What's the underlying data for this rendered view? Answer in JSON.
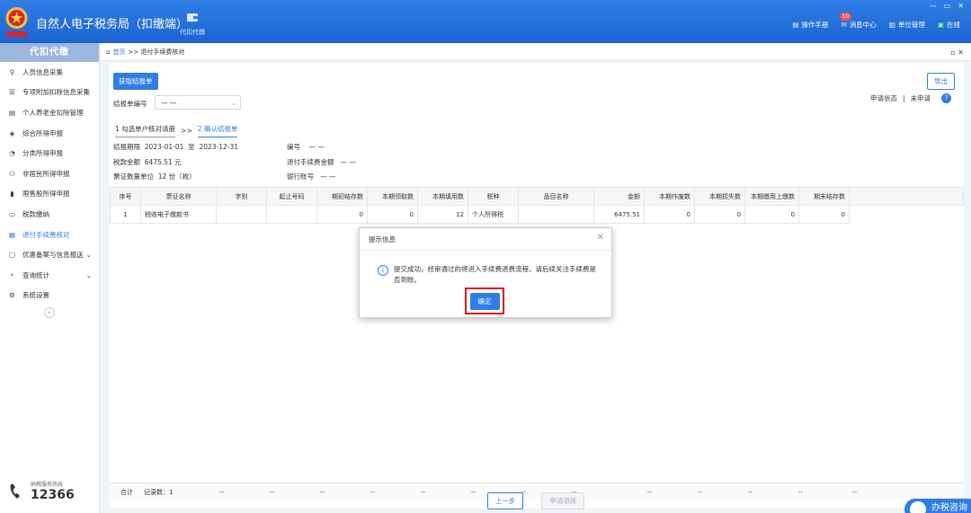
{
  "app": {
    "title": "自然人电子税务局（扣缴端）",
    "nav_label": "代扣代缴",
    "actions": [
      {
        "label": "操作手册",
        "icon": "manual-icon"
      },
      {
        "label": "消息中心",
        "icon": "message-icon",
        "badge": "10"
      },
      {
        "label": "单位管理",
        "icon": "building-icon"
      },
      {
        "label": "在线",
        "icon": "online-icon"
      }
    ]
  },
  "sidebar": {
    "header": "代扣代缴",
    "items": [
      {
        "label": "人员信息采集",
        "icon": "person-icon"
      },
      {
        "label": "专项附加扣除信息采集",
        "icon": "list-icon"
      },
      {
        "label": "个人养老金扣除管理",
        "icon": "pension-icon"
      },
      {
        "label": "综合所得申报",
        "icon": "layers-icon"
      },
      {
        "label": "分类所得申报",
        "icon": "pie-icon"
      },
      {
        "label": "非居民所得申报",
        "icon": "user-foreign-icon"
      },
      {
        "label": "限售股所得申报",
        "icon": "chart-bar-icon"
      },
      {
        "label": "税款缴纳",
        "icon": "wallet-icon"
      },
      {
        "label": "退付手续费核对",
        "icon": "refund-icon"
      },
      {
        "label": "优惠备案与信息报送",
        "icon": "document-icon"
      },
      {
        "label": "查询统计",
        "icon": "search-stats-icon"
      },
      {
        "label": "系统设置",
        "icon": "gear-icon"
      }
    ],
    "hotline_label": "纳税服务热线",
    "hotline_number": "12366"
  },
  "breadcrumb": {
    "home": "首页",
    "separator": ">>",
    "current": "退付手续费核对"
  },
  "page": {
    "fetch_button": "获取结报单",
    "export_button": "导出",
    "report_no_label": "结报单编号",
    "report_no_value": "— —",
    "apply_status_label": "申请状态",
    "apply_status_value": "未申请",
    "step1": "1 勾选单户核对清册",
    "step_sep": ">>",
    "step2": "2 确认结报单",
    "period_label": "结报期限",
    "period_start": "2023-01-01",
    "period_to": "至",
    "period_end": "2023-12-31",
    "bianhao_label": "编号",
    "bianhao_value": "— —",
    "tax_amount_label": "税款金额",
    "tax_amount_value": "6475.51 元",
    "fee_label": "退付手续费金额",
    "fee_value": "— —",
    "voucher_label": "票证数量单位",
    "voucher_value": "12 份（枚）",
    "bank_label": "银行账号",
    "bank_value": "— —"
  },
  "table": {
    "headers": [
      "序号",
      "票证名称",
      "字别",
      "起止号码",
      "期初结存数",
      "本期领取数",
      "本期填用数",
      "税种",
      "品目名称",
      "金额",
      "本期作废数",
      "本期损失数",
      "本期缴用上缴数",
      "期末结存数"
    ],
    "rows": [
      [
        "1",
        "税收电子缴款书",
        "",
        "",
        "0",
        "0",
        "12",
        "个人所得税",
        "",
        "6475.51",
        "0",
        "0",
        "0",
        "0"
      ]
    ],
    "total_label": "合计",
    "count_label": "记录数：1",
    "dash": "--"
  },
  "footer": {
    "prev_button": "上一步",
    "apply_button": "申请退库",
    "consult": "办税咨询"
  },
  "modal": {
    "title": "提示信息",
    "message": "提交成功，经审通过的将进入手续费退费流程，请后续关注手续费是否到账。",
    "confirm": "确定"
  }
}
